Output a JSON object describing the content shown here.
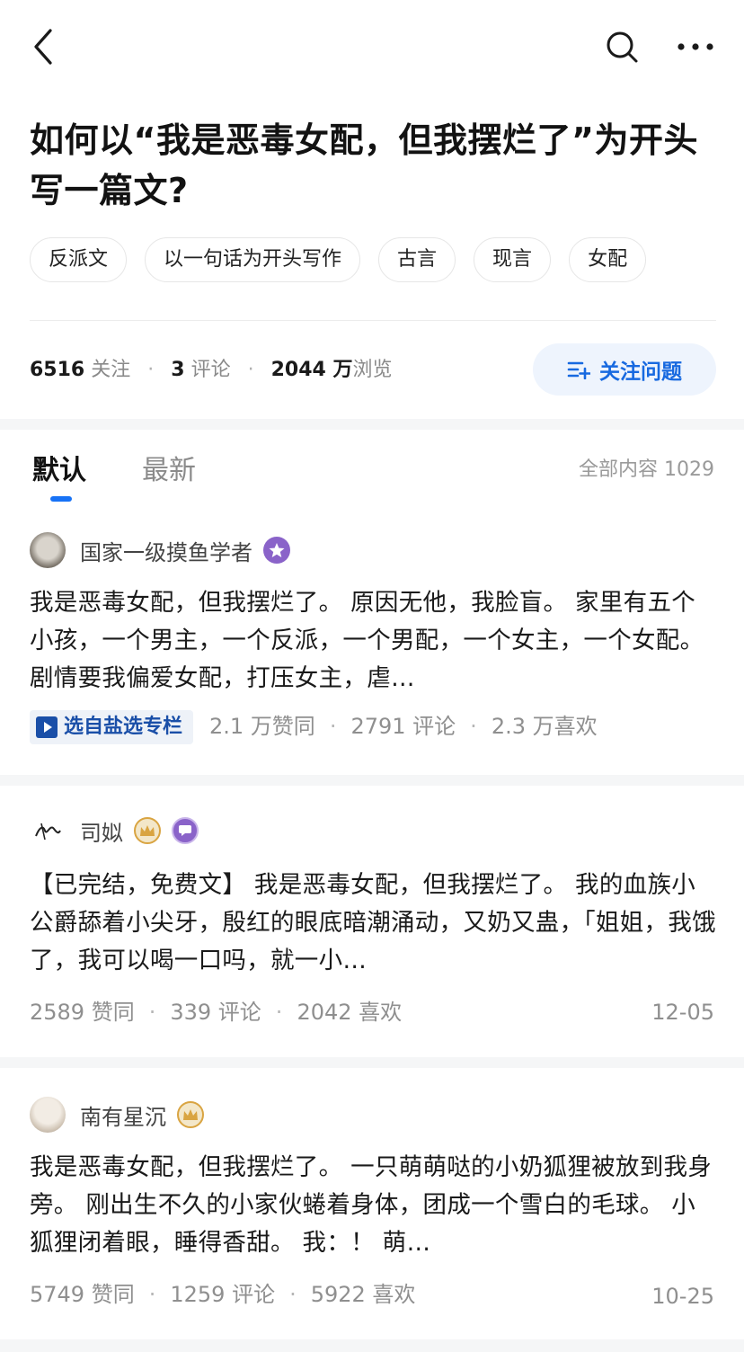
{
  "question": {
    "title": "如何以“我是恶毒女配，但我摆烂了”为开头写一篇文?",
    "tags": [
      "反派文",
      "以一句话为开头写作",
      "古言",
      "现言",
      "女配"
    ],
    "stats": {
      "followers": "6516",
      "followers_label": "关注",
      "comments": "3",
      "comments_label": "评论",
      "views": "2044 万",
      "views_label": "浏览"
    },
    "follow_button": "关注问题"
  },
  "tabs": {
    "default_label": "默认",
    "latest_label": "最新",
    "total_label": "全部内容 1029"
  },
  "answers": [
    {
      "author": "国家一级摸鱼学者",
      "excerpt": "我是恶毒女配，但我摆烂了。 原因无他，我脸盲。 家里有五个小孩，一个男主，一个反派，一个男配，一个女主，一个女配。 剧情要我偏爱女配，打压女主，虐…",
      "column_tag": "选自盐选专栏",
      "likes": "2.1 万赞同",
      "comments": "2791 评论",
      "favorites": "2.3 万喜欢",
      "date": ""
    },
    {
      "author": "司姒",
      "excerpt": "【已完结，免费文】 我是恶毒女配，但我摆烂了。 我的血族小公爵舔着小尖牙，殷红的眼底暗潮涌动，又奶又蛊，「姐姐，我饿了，我可以喝一口吗，就一小…",
      "likes": "2589 赞同",
      "comments": "339 评论",
      "favorites": "2042 喜欢",
      "date": "12-05"
    },
    {
      "author": "南有星沉",
      "excerpt": "我是恶毒女配，但我摆烂了。 一只萌萌哒的小奶狐狸被放到我身旁。 刚出生不久的小家伙蜷着身体，团成一个雪白的毛球。 小狐狸闭着眼，睡得香甜。 我：！ 萌…",
      "likes": "5749 赞同",
      "comments": "1259 评论",
      "favorites": "5922 喜欢",
      "date": "10-25"
    }
  ],
  "colors": {
    "accent": "#1772f6",
    "follow_bg": "#eef4fd",
    "gold_badge": "#d9a441",
    "purple_badge": "#8a63c9"
  }
}
